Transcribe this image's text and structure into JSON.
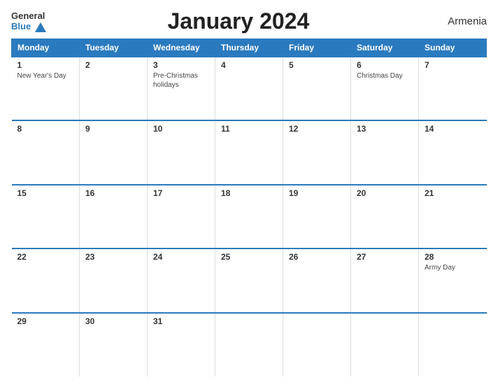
{
  "logo": {
    "line1": "General",
    "line2": "Blue"
  },
  "header": {
    "title": "January 2024",
    "country": "Armenia"
  },
  "weekdays": [
    "Monday",
    "Tuesday",
    "Wednesday",
    "Thursday",
    "Friday",
    "Saturday",
    "Sunday"
  ],
  "weeks": [
    [
      {
        "day": "1",
        "holiday": "New Year's Day"
      },
      {
        "day": "2",
        "holiday": ""
      },
      {
        "day": "3",
        "holiday": "Pre-Christmas holidays"
      },
      {
        "day": "4",
        "holiday": ""
      },
      {
        "day": "5",
        "holiday": ""
      },
      {
        "day": "6",
        "holiday": "Christmas Day"
      },
      {
        "day": "7",
        "holiday": ""
      }
    ],
    [
      {
        "day": "8",
        "holiday": ""
      },
      {
        "day": "9",
        "holiday": ""
      },
      {
        "day": "10",
        "holiday": ""
      },
      {
        "day": "11",
        "holiday": ""
      },
      {
        "day": "12",
        "holiday": ""
      },
      {
        "day": "13",
        "holiday": ""
      },
      {
        "day": "14",
        "holiday": ""
      }
    ],
    [
      {
        "day": "15",
        "holiday": ""
      },
      {
        "day": "16",
        "holiday": ""
      },
      {
        "day": "17",
        "holiday": ""
      },
      {
        "day": "18",
        "holiday": ""
      },
      {
        "day": "19",
        "holiday": ""
      },
      {
        "day": "20",
        "holiday": ""
      },
      {
        "day": "21",
        "holiday": ""
      }
    ],
    [
      {
        "day": "22",
        "holiday": ""
      },
      {
        "day": "23",
        "holiday": ""
      },
      {
        "day": "24",
        "holiday": ""
      },
      {
        "day": "25",
        "holiday": ""
      },
      {
        "day": "26",
        "holiday": ""
      },
      {
        "day": "27",
        "holiday": ""
      },
      {
        "day": "28",
        "holiday": "Army Day"
      }
    ],
    [
      {
        "day": "29",
        "holiday": ""
      },
      {
        "day": "30",
        "holiday": ""
      },
      {
        "day": "31",
        "holiday": ""
      },
      {
        "day": "",
        "holiday": ""
      },
      {
        "day": "",
        "holiday": ""
      },
      {
        "day": "",
        "holiday": ""
      },
      {
        "day": "",
        "holiday": ""
      }
    ]
  ]
}
